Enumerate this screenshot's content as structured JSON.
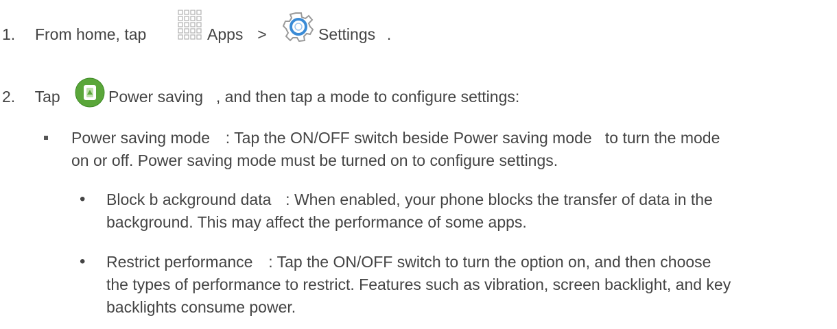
{
  "steps": [
    {
      "number": "1.",
      "text_before": "From home, tap",
      "apps_icon": "apps-grid-icon",
      "apps_label": "Apps",
      "separator": ">",
      "settings_icon": "settings-gear-icon",
      "settings_label": "Settings",
      "end": "."
    },
    {
      "number": "2.",
      "text_before": "Tap",
      "power_icon": "power-saving-icon",
      "power_label": "Power saving",
      "text_after": ", and then tap a mode to configure settings:"
    }
  ],
  "mode": {
    "title": "Power saving mode",
    "line1": ": Tap the ON/OFF switch beside Power saving mode   to turn the mode",
    "line2": "on or off. Power saving mode must be turned on to configure settings."
  },
  "options": [
    {
      "title": "Block b ackground data",
      "line1": ": When enabled, your phone blocks the transfer of data in the",
      "line2": "background. This may affect the performance of some apps."
    },
    {
      "title": "Restrict performance",
      "line1": ": Tap the ON/OFF switch to turn the option on, and then choose",
      "line2": "the types of performance to restrict. Features such as vibration, screen backlight, and key",
      "line3": "backlights consume power."
    }
  ],
  "colors": {
    "text": "#444444",
    "power_icon_green": "#5aa63a",
    "gear_blue": "#3a8bd6"
  }
}
